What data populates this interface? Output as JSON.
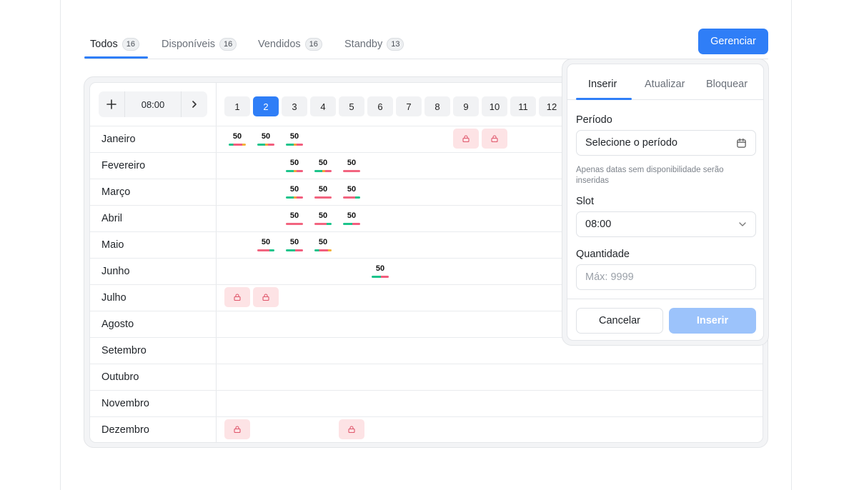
{
  "tabs": [
    {
      "label": "Todos",
      "count": "16"
    },
    {
      "label": "Disponíveis",
      "count": "16"
    },
    {
      "label": "Vendidos",
      "count": "16"
    },
    {
      "label": "Standby",
      "count": "13"
    }
  ],
  "manage_button": "Gerenciar",
  "calendar": {
    "add_icon": "plus-icon",
    "next_icon": "chevron-right-icon",
    "slot_time": "08:00",
    "days": [
      "1",
      "2",
      "3",
      "4",
      "5",
      "6",
      "7",
      "8",
      "9",
      "10",
      "11",
      "12"
    ],
    "selected_day": "2",
    "months": [
      "Janeiro",
      "Fevereiro",
      "Março",
      "Abril",
      "Maio",
      "Junho",
      "Julho",
      "Agosto",
      "Setembro",
      "Outubro",
      "Novembro",
      "Dezembro"
    ],
    "cell_value": "50",
    "rows": [
      {
        "month": "Janeiro",
        "values": {
          "1": "50",
          "2": "50",
          "3": "50"
        },
        "locked": [
          "9",
          "10"
        ]
      },
      {
        "month": "Fevereiro",
        "values": {
          "3": "50",
          "4": "50",
          "5": "50"
        },
        "locked": []
      },
      {
        "month": "Março",
        "values": {
          "3": "50",
          "4": "50",
          "5": "50"
        },
        "locked": []
      },
      {
        "month": "Abril",
        "values": {
          "3": "50",
          "4": "50",
          "5": "50"
        },
        "locked": []
      },
      {
        "month": "Maio",
        "values": {
          "2": "50",
          "3": "50",
          "4": "50"
        },
        "locked": []
      },
      {
        "month": "Junho",
        "values": {
          "6": "50"
        },
        "locked": []
      },
      {
        "month": "Julho",
        "values": {},
        "locked": [
          "1",
          "2"
        ]
      },
      {
        "month": "Agosto",
        "values": {},
        "locked": []
      },
      {
        "month": "Setembro",
        "values": {},
        "locked": []
      },
      {
        "month": "Outubro",
        "values": {},
        "locked": []
      },
      {
        "month": "Novembro",
        "values": {},
        "locked": []
      },
      {
        "month": "Dezembro",
        "values": {},
        "locked": [
          "1",
          "5"
        ]
      }
    ]
  },
  "panel": {
    "tabs": [
      "Inserir",
      "Atualizar",
      "Bloquear"
    ],
    "active_tab": "Inserir",
    "period_label": "Período",
    "period_value": "Selecione o período",
    "period_icon": "calendar-icon",
    "period_help": "Apenas datas sem disponibilidade serão inseridas",
    "slot_label": "Slot",
    "slot_value": "08:00",
    "slot_icon": "chevron-down-icon",
    "quantity_label": "Quantidade",
    "quantity_placeholder": "Máx: 9999",
    "cancel_label": "Cancelar",
    "insert_label": "Inserir"
  },
  "colors": {
    "accent": "#2f7ef7",
    "insert_disabled": "#9cc3fb",
    "lock_bg": "#fde3e5",
    "lock_icon": "#e0566b",
    "bar_green": "#1cc48b",
    "bar_red": "#f25d7d",
    "bar_orange": "#f0a43c"
  }
}
